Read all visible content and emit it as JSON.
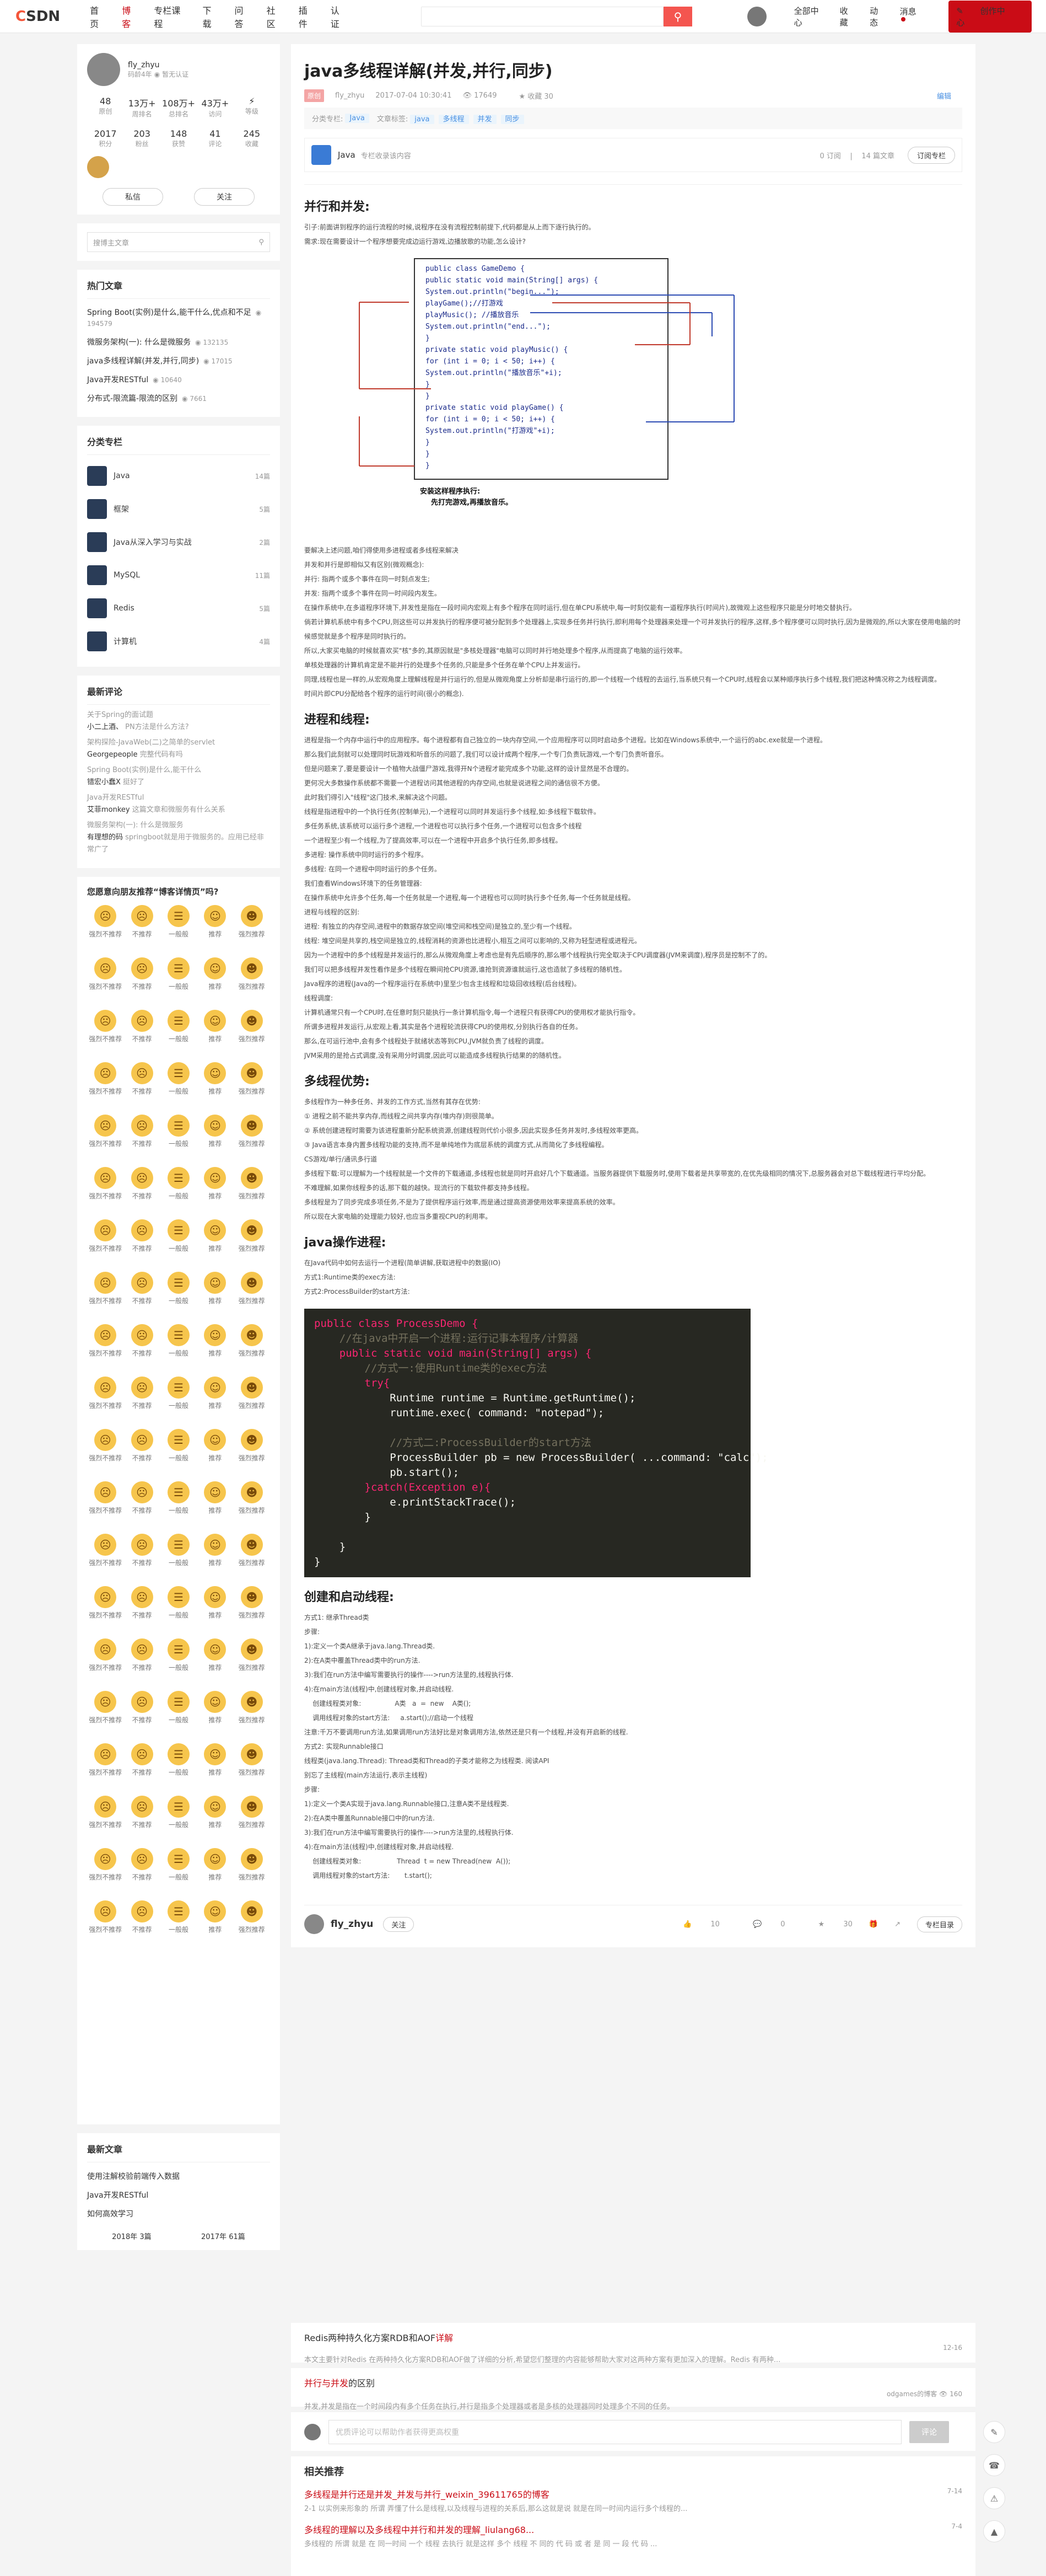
{
  "header": {
    "logo_c": "C",
    "logo_rest": "SDN",
    "nav": [
      "首页",
      "博客",
      "专栏课程",
      "下载",
      "问答",
      "社区",
      "插件",
      "认证"
    ],
    "nav_active": 1,
    "right": [
      "全部中心",
      "收藏",
      "动态",
      "消息"
    ],
    "create": "创作中心"
  },
  "profile": {
    "name": "fly_zhyu",
    "level": "码龄4年",
    "cert": "暂无认证",
    "stats1": [
      {
        "v": "48",
        "l": "原创"
      },
      {
        "v": "13万+",
        "l": "周排名"
      },
      {
        "v": "108万+",
        "l": "总排名"
      },
      {
        "v": "43万+",
        "l": "访问"
      },
      {
        "v": "",
        "l": "等级"
      }
    ],
    "stats2": [
      {
        "v": "2017",
        "l": "积分"
      },
      {
        "v": "203",
        "l": "粉丝"
      },
      {
        "v": "148",
        "l": "获赞"
      },
      {
        "v": "41",
        "l": "评论"
      },
      {
        "v": "245",
        "l": "收藏"
      }
    ],
    "btn_msg": "私信",
    "btn_follow": "关注"
  },
  "search": {
    "placeholder": "搜博主文章"
  },
  "hot": {
    "title": "热门文章",
    "items": [
      {
        "t": "Spring Boot(实例)是什么,能干什么,优点和不足",
        "n": "194579"
      },
      {
        "t": "微服务架构(一): 什么是微服务",
        "n": "132135"
      },
      {
        "t": "java多线程详解(并发,并行,同步)",
        "n": "17015"
      },
      {
        "t": "Java开发RESTful",
        "n": "10640"
      },
      {
        "t": "分布式-限流篇-限流的区别",
        "n": "7661"
      }
    ]
  },
  "cats": {
    "title": "分类专栏",
    "items": [
      {
        "n": "Java",
        "c": "14篇"
      },
      {
        "n": "框架",
        "c": "5篇"
      },
      {
        "n": "Java从深入学习与实战",
        "c": "2篇"
      },
      {
        "n": "MySQL",
        "c": "11篇"
      },
      {
        "n": "Redis",
        "c": "5篇"
      },
      {
        "n": "计算机",
        "c": "4篇"
      }
    ]
  },
  "comments": {
    "title": "最新评论",
    "items": [
      {
        "t": "关于Spring的面试题",
        "u": "小二上酒、",
        "c": "PN方法是什么方法?"
      },
      {
        "t": "架构探险-JavaWeb(二)之简单的servlet",
        "u": "Georgepeople",
        "c": "完整代码有吗"
      },
      {
        "t": "Spring Boot(实例)是什么,能干什么",
        "u": "错宏小蠢X",
        "c": "挺好了"
      },
      {
        "t": "Java开发RESTful",
        "u": "艾菲monkey",
        "c": "这篇文章和微服务有什么关系"
      },
      {
        "t": "微服务架构(一): 什么是微服务",
        "u": "有理想的码",
        "c": "springboot就是用于微服务的。应用已经非常广了"
      }
    ]
  },
  "vote": {
    "title": "您愿意向朋友推荐“博客详情页”吗?",
    "labels": [
      "强烈不推荐",
      "不推荐",
      "一般般",
      "推荐",
      "强烈推荐"
    ]
  },
  "latest": {
    "title": "最新文章",
    "items": [
      "使用注解校验前端传入数据",
      "Java开发RESTful",
      "如何高效学习"
    ],
    "years": [
      {
        "y": "2018年",
        "n": "3篇"
      },
      {
        "y": "2017年",
        "n": "61篇"
      }
    ]
  },
  "article": {
    "title": "java多线程详解(并发,并行,同步)",
    "orig": "原创",
    "author": "fly_zhyu",
    "date": "2017-07-04 10:30:41",
    "views": "17649",
    "fav": "收藏 30",
    "edit": "编辑",
    "cat_label": "分类专栏:",
    "cat": "Java",
    "tag_label": "文章标签:",
    "tags": [
      "java",
      "多线程",
      "并发",
      "同步"
    ],
    "col_name": "Java",
    "col_desc": "专栏收录该内容",
    "col_subs": "0 订阅",
    "col_count": "14 篇文章",
    "col_btn": "订阅专栏",
    "h_par": "并行和并发:",
    "p_intro": [
      "引子:前面讲到程序的运行流程的时候,说程序在没有流程控制前提下,代码都是从上而下逐行执行的。",
      "需求:现在需要设计一个程序想要完成边运行游戏,边播放歌的功能,怎么设计?"
    ],
    "p_par": [
      "要解决上述问题,咱们得使用多进程或者多线程来解决",
      "并发和并行是即相似又有区别(微观概念):",
      "并行: 指两个或多个事件在同一时刻点发生;",
      "并发: 指两个或多个事件在同一时间段内发生。",
      "在操作系统中,在多道程序环境下,并发性是指在一段时间内宏观上有多个程序在同时运行,但在单CPU系统中,每一时刻仅能有一道程序执行(时间片),故微观上这些程序只能是分时地交替执行。",
      "倘若计算机系统中有多个CPU,则这些可以并发执行的程序便可被分配到多个处理器上,实现多任务并行执行,即利用每个处理器来处理一个可并发执行的程序,这样,多个程序便可以同时执行,因为是微观的,所以大家在使用电脑的时候感觉就是多个程序是同时执行的。",
      "所以,大家买电脑的时候就喜欢买\"核\"多的,其原因就是\"多核处理器\"电脑可以同时并行地处理多个程序,从而提高了电脑的运行效率。",
      "单核处理器的计算机肯定是不能并行的处理多个任务的,只能是多个任务在单个CPU上并发运行。",
      "同理,线程也是一样的,从宏观角度上理解线程是并行运行的,但是从微观角度上分析却是串行运行的,即一个线程一个线程的去运行,当系统只有一个CPU时,线程会以某种顺序执行多个线程,我们把这种情况称之为线程调度。",
      "时间片即CPU分配给各个程序的运行时间(很小的概念)."
    ],
    "h_proc": "进程和线程:",
    "p_proc": [
      "进程是指一个内存中运行中的应用程序。每个进程都有自己独立的一块内存空间,一个应用程序可以同时启动多个进程。比如在Windows系统中,一个运行的abc.exe就是一个进程。",
      "那么我们此刻就可以处理同时玩游戏和听音乐的问题了,我们可以设计成两个程序,一个专门负责玩游戏,一个专门负责听音乐。",
      "但是问题来了,要是要设计一个植物大战僵尸游戏,我得开N个进程才能完成多个功能,这样的设计显然是不合理的。",
      "更何况大多数操作系统都不需要一个进程访问其他进程的内存空间,也就是说进程之间的通信很不方便。",
      "此时我们得引入\"线程\"这门技术,来解决这个问题。",
      "线程是指进程中的一个执行任务(控制单元),一个进程可以同时并发运行多个线程,如:多线程下载软件。",
      "多任务系统,该系统可以运行多个进程,一个进程也可以执行多个任务,一个进程可以包含多个线程",
      "一个进程至少有一个线程,为了提高效率,可以在一个进程中开启多个执行任务,即多线程。",
      "多进程: 操作系统中同时运行的多个程序。",
      "多线程: 在同一个进程中同时运行的多个任务。",
      "我们查看Windows环境下的任务管理器:",
      "在操作系统中允许多个任务,每一个任务就是一个进程,每一个进程也可以同时执行多个任务,每一个任务就是线程。",
      "进程与线程的区别:",
      "进程: 有独立的内存空间,进程中的数据存放空间(堆空间和栈空间)是独立的,至少有一个线程。",
      "线程: 堆空间是共享的,栈空间是独立的,线程消耗的资源也比进程小,相互之间可以影响的,又称为轻型进程或进程元。",
      "因为一个进程中的多个线程是并发运行的,那么从微观角度上考虑也是有先后顺序的,那么哪个线程执行完全取决于CPU调度器(JVM来调度),程序员是控制不了的。",
      "我们可以把多线程并发性看作是多个线程在瞬间抢CPU资源,谁抢到资源谁就运行,这也造就了多线程的随机性。",
      "Java程序的进程(Java的一个程序运行在系统中)里至少包含主线程和垃圾回收线程(后台线程)。",
      "线程调度:",
      "计算机通常只有一个CPU时,在任意时刻只能执行一条计算机指令,每一个进程只有获得CPU的使用权才能执行指令。",
      "所谓多进程并发运行,从宏观上看,其实是各个进程轮流获得CPU的使用权,分别执行各自的任务。",
      "那么,在可运行池中,会有多个线程处于就绪状态等到CPU,JVM就负责了线程的调度。",
      "JVM采用的是抢占式调度,没有采用分时调度,因此可以能造成多线程执行结果的的随机性。"
    ],
    "h_adv": "多线程优势:",
    "p_adv": [
      "多线程作为一种多任务、并发的工作方式,当然有其存在优势:",
      "① 进程之前不能共享内存,而线程之间共享内存(堆内存)则很简单。",
      "② 系统创建进程时需要为该进程重新分配系统资源,创建线程则代价小很多,因此实现多任务并发时,多线程效率更高。",
      "③ Java语言本身内置多线程功能的支持,而不是单纯地作为底层系统的调度方式,从而简化了多线程编程。",
      "CS游戏/单行/通讯多行道",
      "多线程下载:可以理解为一个线程就是一个文件的下载通道,多线程也就是同时开启好几个下载通道。当服务器提供下载服务时,使用下载者是共享带宽的,在优先级相同的情况下,总服务器会对总下载线程进行平均分配。",
      "不难理解,如果你线程多的话,那下载的越快。现流行的下载软件都支持多线程。",
      "多线程是为了同步完成多项任务,不是为了提供程序运行效率,而是通过提高资源使用效率来提高系统的效率。",
      "所以现在大家电脑的处理能力较好,也应当多重视CPU的利用率。"
    ],
    "h_op": "java操作进程:",
    "p_op": [
      "在Java代码中如何去运行一个进程(简单讲解,获取进程中的数据(IO)",
      "方式1:Runtime类的exec方法:",
      "方式2:ProcessBuilder的start方法:"
    ],
    "h_thr": "创建和启动线程:",
    "p_thr": [
      "方式1: 继承Thread类",
      "步骤:",
      "1):定义一个类A继承于java.lang.Thread类.",
      "2):在A类中覆盖Thread类中的run方法.",
      "3):我们在run方法中编写需要执行的操作---->run方法里的,线程执行体.",
      "4):在main方法(线程)中,创建线程对象,并启动线程.",
      "    创建线程类对象:                A类   a  =  new    A类();",
      "    调用线程对象的start方法:     a.start();//启动一个线程",
      "注意:千万不要调用run方法,如果调用run方法好比是对象调用方法,依然还是只有一个线程,并没有开启新的线程.",
      "方式2: 实现Runnable接口",
      "线程类(java.lang.Thread): Thread类和Thread的子类才能称之为线程类. 阅读API",
      "别忘了主线程(main方法运行,表示主线程)",
      "步骤:",
      "1):定义一个类A实现于java.lang.Runnable接口,注意A类不是线程类.",
      "2):在A类中覆盖Runnable接口中的run方法.",
      "3):我们在run方法中编写需要执行的操作---->run方法里的,线程执行体.",
      "4):在main方法(线程)中,创建线程对象,并启动线程.",
      "    创建线程类对象:                 Thread  t = new Thread(new  A());",
      "    调用线程对象的start方法:       t.start();"
    ],
    "fig_lines": [
      "public class GameDemo {",
      "    public static void main(String[] args) {",
      "        System.out.println(\"begin...\");",
      "        playGame();//打游戏",
      "        playMusic(); //播放音乐",
      "        System.out.println(\"end...\");",
      "    }",
      "    private static void playMusic() {",
      "        for (int i = 0; i < 50; i++) {",
      "            System.out.println(\"播放音乐\"+i);",
      "        }",
      "    }",
      "    private static void playGame() {",
      "        for (int i = 0; i < 50; i++) {",
      "            System.out.println(\"打游戏\"+i);",
      "        }",
      "    }",
      "}"
    ],
    "fig_caption": [
      "安装这样程序执行:",
      "先打完游戏,再播放音乐。"
    ],
    "code_lines": [
      {
        "t": "public class ProcessDemo {",
        "c": "k"
      },
      {
        "t": "    //在java中开启一个进程:运行记事本程序/计算器",
        "c": "cm"
      },
      {
        "t": "    public static void main(String[] args) {",
        "c": "k"
      },
      {
        "t": "        //方式一:使用Runtime类的exec方法",
        "c": "cm"
      },
      {
        "t": "        try{",
        "c": "k"
      },
      {
        "t": "            Runtime runtime = Runtime.getRuntime();",
        "c": "n"
      },
      {
        "t": "            runtime.exec( command: \"notepad\");",
        "c": "n"
      },
      {
        "t": "",
        "c": "n"
      },
      {
        "t": "            //方式二:ProcessBuilder的start方法",
        "c": "cm"
      },
      {
        "t": "            ProcessBuilder pb = new ProcessBuilder( ...command: \"calc\");",
        "c": "n"
      },
      {
        "t": "            pb.start();",
        "c": "n"
      },
      {
        "t": "        }catch(Exception e){",
        "c": "k"
      },
      {
        "t": "            e.printStackTrace();",
        "c": "n"
      },
      {
        "t": "        }",
        "c": "n"
      },
      {
        "t": "",
        "c": "n"
      },
      {
        "t": "    }",
        "c": "n"
      },
      {
        "t": "}",
        "c": "n"
      }
    ],
    "like": "10",
    "cmt": "0",
    "star": "30",
    "col_dir": "专栏目录"
  },
  "related": [
    {
      "pre": "Redis两种持久化方案RDB和AOF",
      "em": "详解",
      "desc": "本文主要针对Redis 在两种持久化方案RDB和AOF做了详细的分析,希望您们整理的内容能够帮助大家对这两种方案有更加深入的理解。Redis 有两种...",
      "date": "12-16",
      "user": "",
      "views": ""
    },
    {
      "pre": "并行与并发",
      "em": "的区别",
      "desc": "并发,并发是指在一个时间段内有多个任务在执行,并行是指多个处理器或者是多核的处理器同时处理多个不同的任务。",
      "date": "",
      "user": "odgames的博客",
      "views": "160"
    }
  ],
  "comment_box": {
    "placeholder": "优质评论可以帮助作者获得更高权重",
    "btn": "评论"
  },
  "rec": {
    "title": "相关推荐",
    "items": [
      {
        "t": "多线程是并行还是并发_并发与并行_weixin_39611765的博客",
        "d": "2-1 以实例来形象的 所谓 弄懂了什么是线程,以及线程与进程的关系后,那么这就是说 就是在同一时间内运行多个线程的...",
        "date": "7-14"
      },
      {
        "t": "多线程的理解以及多线程中并行和并发的理解_liulang68...",
        "d": "多线程的 所谓 就是 在 同一时间 一个 线程 去执行 就是这样 多个 线程 不 同的 代 码 或 者 是 同 一 段 代 码 ...",
        "date": "7-4"
      }
    ]
  },
  "float": [
    "ai-icon",
    "headset-icon",
    "feedback-icon",
    "top-icon"
  ]
}
